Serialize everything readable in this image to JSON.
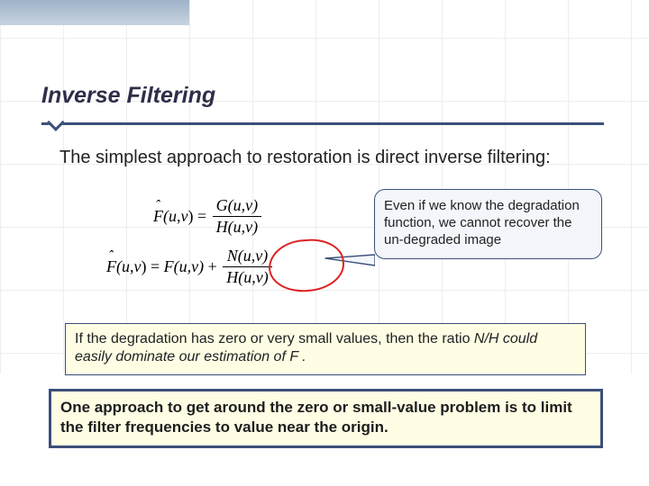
{
  "title": "Inverse Filtering",
  "intro": "The simplest approach to restoration is direct inverse filtering:",
  "eq1": {
    "lhs": "F̂(u,v)",
    "num": "G(u,v)",
    "den": "H(u,v)"
  },
  "eq2": {
    "lhs": "F̂(u,v)",
    "mid": "F(u,v)",
    "num": "N(u,v)",
    "den": "H(u,v)"
  },
  "callout": "Even if we know the degradation function, we cannot recover the un-degraded image",
  "note1_a": "If the degradation has zero or very small values, then the ratio ",
  "note1_b": "N/H could easily dominate our estimation of F .",
  "note2": "One approach to get around the zero or small-value problem is to limit the filter frequencies to value near the origin."
}
